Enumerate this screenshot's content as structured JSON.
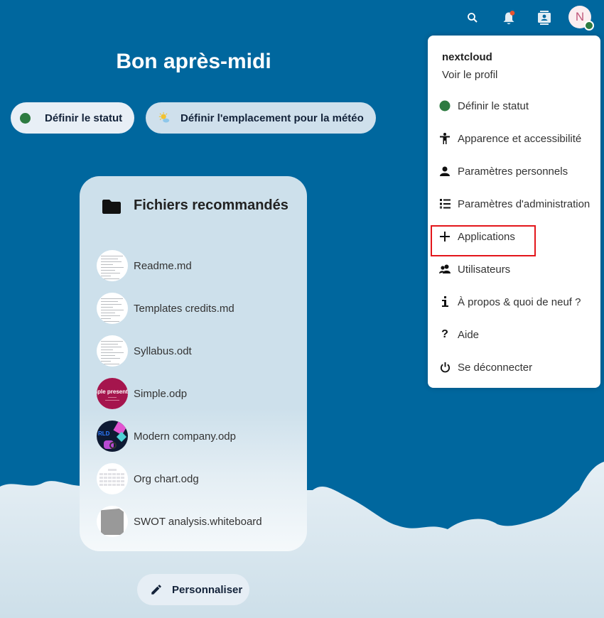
{
  "header": {
    "icons": [
      {
        "name": "search-icon"
      },
      {
        "name": "notifications-icon",
        "badge_color": "#e9532f"
      },
      {
        "name": "contacts-icon"
      }
    ],
    "avatar": {
      "initial": "N",
      "status_color": "#2d7b41"
    }
  },
  "greeting": "Bon après-midi",
  "actions": {
    "status_label": "Définir le statut",
    "weather_label": "Définir l'emplacement pour la météo"
  },
  "recommended": {
    "title": "Fichiers recommandés",
    "files": [
      {
        "name": "Readme.md",
        "thumb": "doc"
      },
      {
        "name": "Templates credits.md",
        "thumb": "doc"
      },
      {
        "name": "Syllabus.odt",
        "thumb": "doc"
      },
      {
        "name": "Simple.odp",
        "thumb": "simple",
        "thumb_text": "mple presentati"
      },
      {
        "name": "Modern company.odp",
        "thumb": "modern",
        "thumb_text": "RLD"
      },
      {
        "name": "Org chart.odg",
        "thumb": "org"
      },
      {
        "name": "SWOT analysis.whiteboard",
        "thumb": "swot"
      }
    ]
  },
  "personalize_label": "Personnaliser",
  "user_menu": {
    "username": "nextcloud",
    "profile_link": "Voir le profil",
    "items": [
      {
        "label": "Définir le statut",
        "icon": "status-dot-icon"
      },
      {
        "label": "Apparence et accessibilité",
        "icon": "accessibility-icon"
      },
      {
        "label": "Paramètres personnels",
        "icon": "user-icon"
      },
      {
        "label": "Paramètres d'administration",
        "icon": "admin-list-icon"
      },
      {
        "label": "Applications",
        "icon": "plus-icon",
        "highlighted": true
      },
      {
        "label": "Utilisateurs",
        "icon": "users-icon"
      },
      {
        "label": "À propos & quoi de neuf ?",
        "icon": "info-icon"
      },
      {
        "label": "Aide",
        "icon": "help-icon"
      },
      {
        "label": "Se déconnecter",
        "icon": "power-icon"
      }
    ],
    "highlight_color": "#e3161b"
  }
}
